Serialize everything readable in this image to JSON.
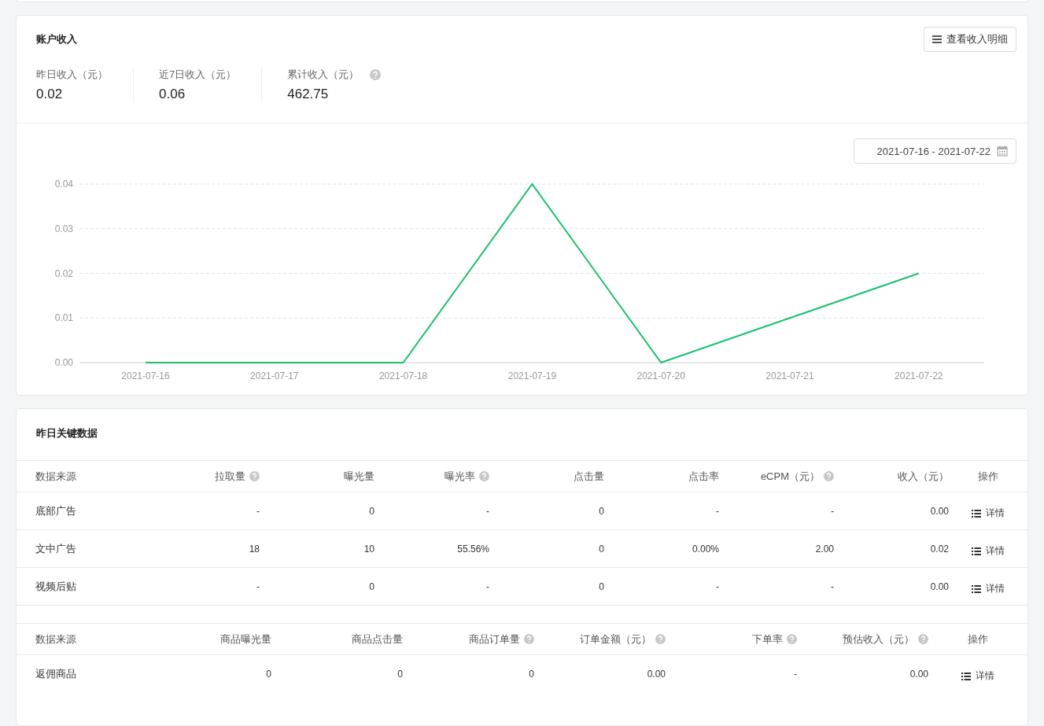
{
  "income": {
    "title": "账户收入",
    "detail_button": "查看收入明细",
    "stats": [
      {
        "label": "昨日收入（元）",
        "value": "0.02",
        "help": false
      },
      {
        "label": "近7日收入（元）",
        "value": "0.06",
        "help": false
      },
      {
        "label": "累计收入（元）",
        "value": "462.75",
        "help": true
      }
    ],
    "date_range": "2021-07-16 - 2021-07-22",
    "chart_data": {
      "type": "line",
      "categories": [
        "2021-07-16",
        "2021-07-17",
        "2021-07-18",
        "2021-07-19",
        "2021-07-20",
        "2021-07-21",
        "2021-07-22"
      ],
      "series": [
        {
          "color": "#19c16b",
          "values": [
            0,
            0,
            0,
            0.04,
            0,
            0.01,
            0.02
          ]
        }
      ],
      "ylim": [
        0,
        0.04
      ],
      "grid": true,
      "yticks": [
        {
          "value": 0,
          "label": "0.00"
        },
        {
          "value": 0.01,
          "label": "0.01"
        },
        {
          "value": 0.02,
          "label": "0.02"
        },
        {
          "value": 0.03,
          "label": "0.03"
        },
        {
          "value": 0.04,
          "label": "0.04"
        }
      ]
    }
  },
  "key_data": {
    "title": "昨日关键数据",
    "ad_table": {
      "columns": [
        {
          "label": "数据来源",
          "help": false
        },
        {
          "label": "拉取量",
          "help": true
        },
        {
          "label": "曝光量",
          "help": false
        },
        {
          "label": "曝光率",
          "help": true
        },
        {
          "label": "点击量",
          "help": false
        },
        {
          "label": "点击率",
          "help": false
        },
        {
          "label": "eCPM（元）",
          "help": true
        },
        {
          "label": "收入（元）",
          "help": false
        },
        {
          "label": "操作",
          "help": false
        }
      ],
      "rows": [
        {
          "cells": [
            "底部广告",
            "-",
            "0",
            "-",
            "0",
            "-",
            "-",
            "0.00"
          ],
          "action": "详情"
        },
        {
          "cells": [
            "文中广告",
            "18",
            "10",
            "55.56%",
            "0",
            "0.00%",
            "2.00",
            "0.02"
          ],
          "action": "详情"
        },
        {
          "cells": [
            "视频后贴",
            "-",
            "0",
            "-",
            "0",
            "-",
            "-",
            "0.00"
          ],
          "action": "详情"
        }
      ]
    },
    "product_table": {
      "columns": [
        {
          "label": "数据来源",
          "help": false
        },
        {
          "label": "商品曝光量",
          "help": false
        },
        {
          "label": "商品点击量",
          "help": false
        },
        {
          "label": "商品订单量",
          "help": true
        },
        {
          "label": "订单金额（元）",
          "help": true
        },
        {
          "label": "下单率",
          "help": true
        },
        {
          "label": "预估收入（元）",
          "help": true
        },
        {
          "label": "操作",
          "help": false
        }
      ],
      "rows": [
        {
          "cells": [
            "返佣商品",
            "0",
            "0",
            "0",
            "0.00",
            "-",
            "0.00"
          ],
          "action": "详情"
        }
      ]
    }
  }
}
